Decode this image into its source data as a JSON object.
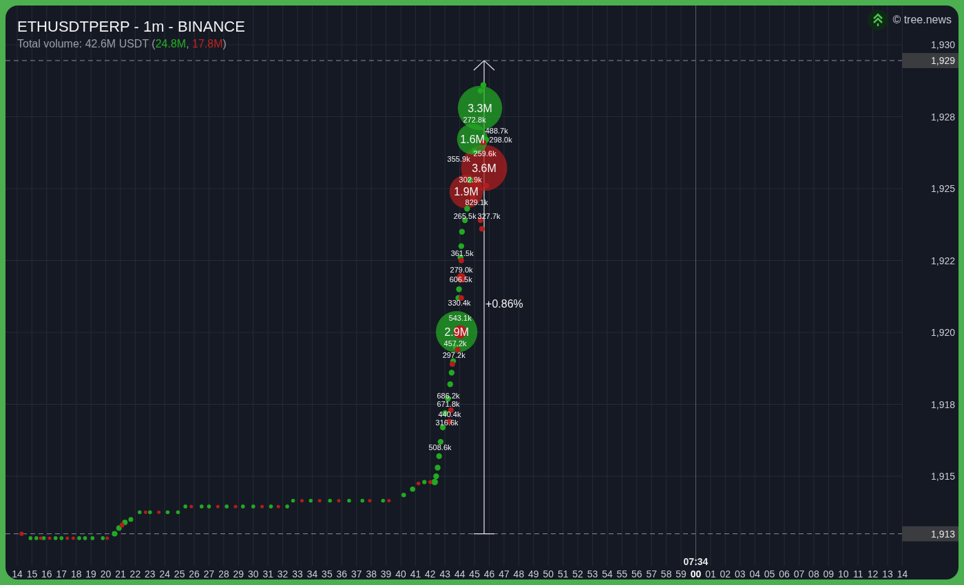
{
  "header": {
    "title": "ETHUSDTPERP - 1m - BINANCE",
    "volume": {
      "prefix": "Total volume: 42.6M USDT (",
      "buy": "24.8M",
      "separator": ", ",
      "sell": "17.8M",
      "suffix": ")"
    }
  },
  "brand": {
    "text": "© tree.news"
  },
  "chart": {
    "price_axis": {
      "labels": [
        "1,930",
        "1,928",
        "1,925",
        "1,922",
        "1,920",
        "1,918",
        "1,915"
      ]
    },
    "time_axis": {
      "labels": [
        "14",
        "15",
        "16",
        "17",
        "18",
        "19",
        "20",
        "21",
        "22",
        "23",
        "24",
        "25",
        "26",
        "27",
        "28",
        "29",
        "30",
        "31",
        "32",
        "33",
        "34",
        "35",
        "36",
        "37",
        "38",
        "39",
        "40",
        "41",
        "42",
        "43",
        "44",
        "45",
        "46",
        "47",
        "48",
        "49",
        "50",
        "51",
        "52",
        "53",
        "54",
        "55",
        "56",
        "57",
        "58",
        "59",
        "00",
        "01",
        "02",
        "03",
        "04",
        "05",
        "06",
        "07",
        "08",
        "09",
        "10",
        "11",
        "12",
        "13",
        "14"
      ]
    },
    "price_tags": [
      "1,929",
      "1,913"
    ],
    "time_marker": "07:34",
    "change": "+0.86%",
    "volume_labels": [
      "3.3M",
      "1.6M",
      "3.6M",
      "1.9M",
      "2.9M",
      "272.8k",
      "488.7k",
      "298.0k",
      "259.6k",
      "355.9k",
      "302.9k",
      "829.1k",
      "265.5k",
      "327.7k",
      "361.5k",
      "279.0k",
      "606.5k",
      "330.4k",
      "543.1k",
      "457.2k",
      "297.2k",
      "686.2k",
      "671.8k",
      "440.4k",
      "316.6k",
      "508.6k"
    ]
  }
}
